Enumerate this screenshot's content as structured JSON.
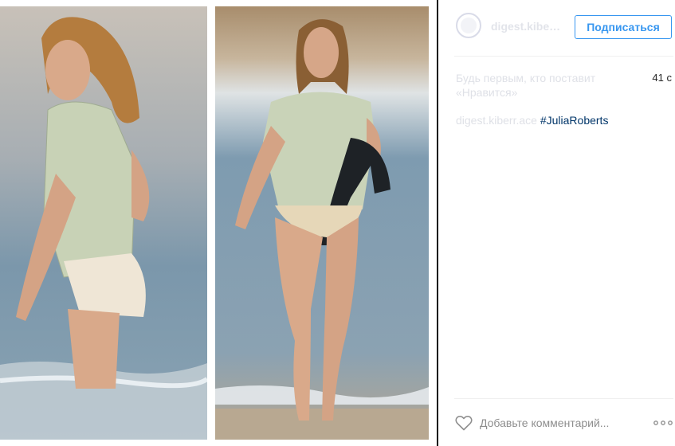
{
  "post": {
    "username": "digest.kiberr...",
    "follow_label": "Подписаться",
    "caption": "Будь первым, кто поставит «Нравится»",
    "time": "41 с",
    "comment_user": "digest.kiberr.ace",
    "hashtag": "#JuliaRoberts",
    "comment_placeholder": "Добавьте комментарий...",
    "more_glyph": "•••"
  },
  "colors": {
    "accent": "#3897f0",
    "hashtag": "#003569",
    "divider": "#111111",
    "sea": "#6f8fa6",
    "sand": "#b9a58c"
  },
  "icons": {
    "like": "heart-outline-icon",
    "more": "ellipsis-icon"
  }
}
